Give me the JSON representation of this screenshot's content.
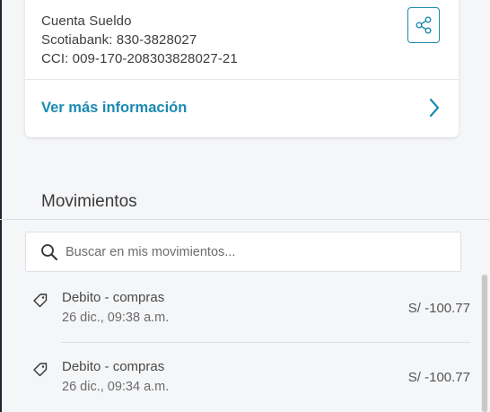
{
  "account_card": {
    "account_type": "Cuenta Sueldo",
    "account_number_line": "Scotiabank: 830-3828027",
    "cci_line": "CCI: 009-170-208303828027-21",
    "share_icon": "share-icon",
    "more_info_label": "Ver más información",
    "more_info_icon": "chevron-right-icon"
  },
  "movements": {
    "title": "Movimientos",
    "search": {
      "placeholder": "Buscar en mis movimientos...",
      "value": "",
      "icon": "search-icon"
    },
    "items": [
      {
        "icon": "tag-icon",
        "title": "Debito - compras",
        "date": "26 dic., 09:38 a.m.",
        "amount": "S/ -100.77"
      },
      {
        "icon": "tag-icon",
        "title": "Debito - compras",
        "date": "26 dic., 09:34 a.m.",
        "amount": "S/ -100.77"
      }
    ]
  },
  "colors": {
    "accent": "#1b8ab1",
    "background": "#f5f6f8",
    "card": "#ffffff"
  }
}
